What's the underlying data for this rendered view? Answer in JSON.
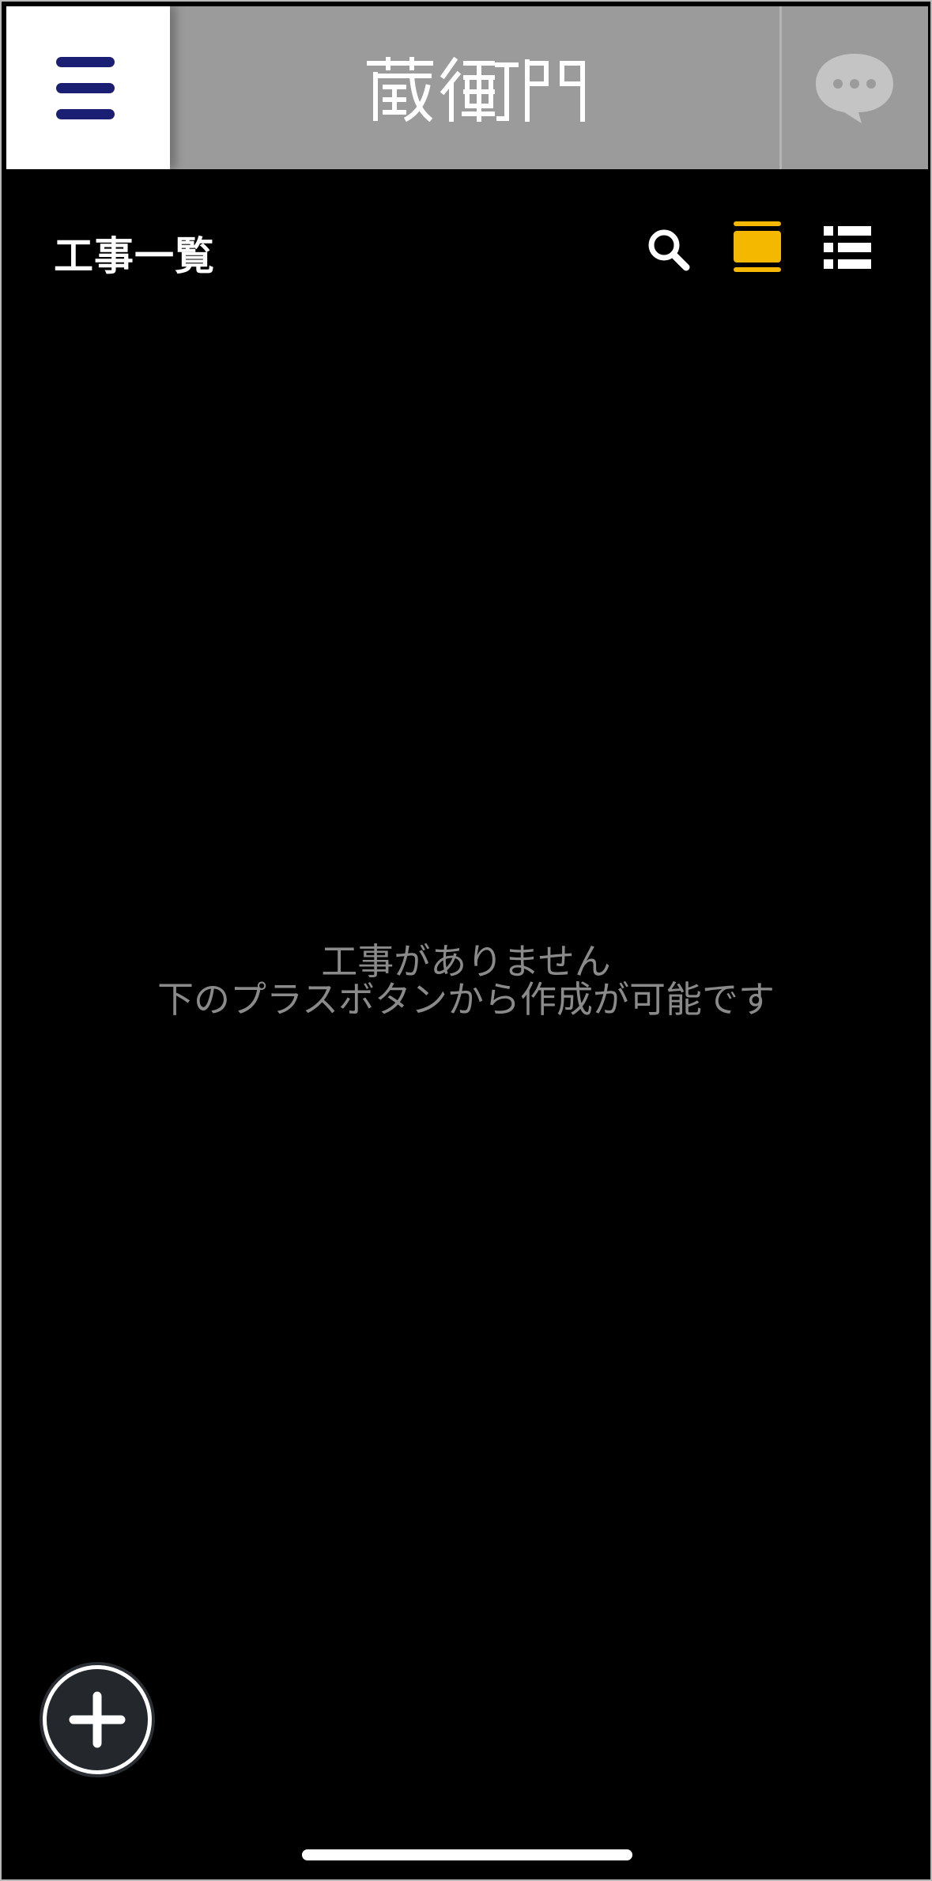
{
  "app": {
    "logo_text": "蔵衛門"
  },
  "toolbar": {
    "title": "工事一覧"
  },
  "empty_state": {
    "line1": "工事がありません",
    "line2": "下のプラスボタンから作成が可能です"
  },
  "icons": {
    "menu": "hamburger-menu-icon",
    "chat": "chat-bubble-icon",
    "search": "search-icon",
    "card_view": "card-view-icon",
    "list_view": "list-view-icon",
    "add": "plus-icon"
  },
  "colors": {
    "header_bg": "#9b9b9b",
    "menu_bar": "#1b1f73",
    "active_view": "#f5b800",
    "empty_text": "#8a8a8a"
  }
}
